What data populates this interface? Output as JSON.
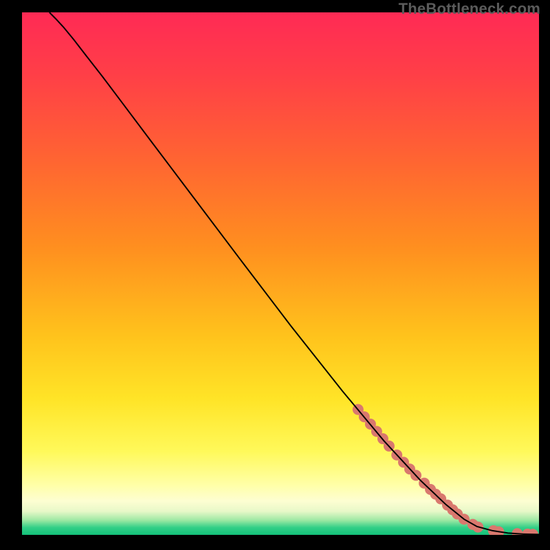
{
  "watermark": "TheBottleneck.com",
  "chart_data": {
    "type": "line",
    "title": "",
    "xlabel": "",
    "ylabel": "",
    "xlim": [
      0,
      100
    ],
    "ylim": [
      0,
      100
    ],
    "grid": false,
    "legend": false,
    "background_gradient_stops": [
      {
        "offset": 0.0,
        "color": "#ff2a55"
      },
      {
        "offset": 0.12,
        "color": "#ff3f47"
      },
      {
        "offset": 0.28,
        "color": "#ff6432"
      },
      {
        "offset": 0.45,
        "color": "#ff8f1f"
      },
      {
        "offset": 0.62,
        "color": "#ffc31c"
      },
      {
        "offset": 0.74,
        "color": "#ffe427"
      },
      {
        "offset": 0.84,
        "color": "#fff95a"
      },
      {
        "offset": 0.905,
        "color": "#ffffa8"
      },
      {
        "offset": 0.935,
        "color": "#fdfed2"
      },
      {
        "offset": 0.955,
        "color": "#e8f8c8"
      },
      {
        "offset": 0.972,
        "color": "#9de8a3"
      },
      {
        "offset": 0.986,
        "color": "#32cf87"
      },
      {
        "offset": 1.0,
        "color": "#14c27a"
      }
    ],
    "series": [
      {
        "name": "curve",
        "type": "line",
        "color": "#000000",
        "width": 2,
        "points": [
          {
            "x": 5.3,
            "y": 100.0
          },
          {
            "x": 6.5,
            "y": 98.8
          },
          {
            "x": 8.0,
            "y": 97.2
          },
          {
            "x": 10.0,
            "y": 94.8
          },
          {
            "x": 12.5,
            "y": 91.6
          },
          {
            "x": 15.5,
            "y": 87.8
          },
          {
            "x": 19.0,
            "y": 83.2
          },
          {
            "x": 25.0,
            "y": 75.3
          },
          {
            "x": 33.0,
            "y": 64.8
          },
          {
            "x": 42.0,
            "y": 53.0
          },
          {
            "x": 52.0,
            "y": 40.0
          },
          {
            "x": 62.0,
            "y": 27.5
          },
          {
            "x": 70.0,
            "y": 18.0
          },
          {
            "x": 77.0,
            "y": 10.5
          },
          {
            "x": 82.0,
            "y": 5.8
          },
          {
            "x": 85.5,
            "y": 3.0
          },
          {
            "x": 88.0,
            "y": 1.6
          },
          {
            "x": 91.0,
            "y": 0.8
          },
          {
            "x": 94.0,
            "y": 0.35
          },
          {
            "x": 97.0,
            "y": 0.15
          },
          {
            "x": 100.0,
            "y": 0.08
          }
        ]
      },
      {
        "name": "highlight-dots",
        "type": "scatter",
        "color": "#d9786e",
        "radius": 8,
        "points": [
          {
            "x": 65.0,
            "y": 24.0
          },
          {
            "x": 66.2,
            "y": 22.6
          },
          {
            "x": 67.4,
            "y": 21.2
          },
          {
            "x": 68.6,
            "y": 19.8
          },
          {
            "x": 69.8,
            "y": 18.4
          },
          {
            "x": 71.0,
            "y": 17.0
          },
          {
            "x": 72.5,
            "y": 15.3
          },
          {
            "x": 73.8,
            "y": 13.9
          },
          {
            "x": 75.0,
            "y": 12.6
          },
          {
            "x": 76.2,
            "y": 11.4
          },
          {
            "x": 77.8,
            "y": 9.9
          },
          {
            "x": 79.0,
            "y": 8.7
          },
          {
            "x": 80.0,
            "y": 7.8
          },
          {
            "x": 81.0,
            "y": 6.9
          },
          {
            "x": 82.3,
            "y": 5.7
          },
          {
            "x": 83.3,
            "y": 4.8
          },
          {
            "x": 84.2,
            "y": 4.0
          },
          {
            "x": 85.5,
            "y": 3.0
          },
          {
            "x": 87.2,
            "y": 2.0
          },
          {
            "x": 88.2,
            "y": 1.5
          },
          {
            "x": 91.2,
            "y": 0.8
          },
          {
            "x": 92.2,
            "y": 0.6
          },
          {
            "x": 95.8,
            "y": 0.25
          },
          {
            "x": 97.8,
            "y": 0.15
          },
          {
            "x": 98.8,
            "y": 0.1
          }
        ]
      }
    ]
  }
}
